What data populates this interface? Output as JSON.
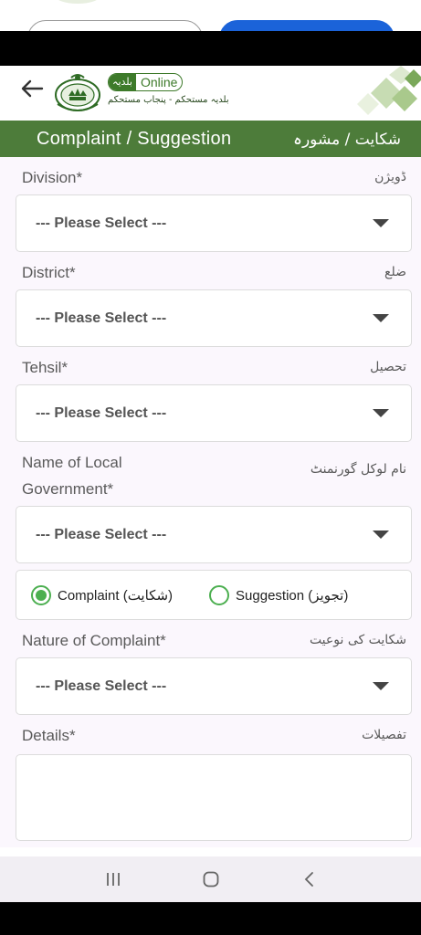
{
  "header": {
    "logo_pill_urdu": "بلدیہ",
    "logo_pill_en": "Online",
    "logo_tagline": "بلدیہ مستحکم - پنجاب مستحکم"
  },
  "title_bar": {
    "title_en": "Complaint / Suggestion",
    "title_ur": "شکایت / مشورہ"
  },
  "form": {
    "division": {
      "label_en": "Division*",
      "label_ur": "ڈویژن",
      "value": "--- Please Select ---"
    },
    "district": {
      "label_en": "District*",
      "label_ur": "ضلع",
      "value": "--- Please Select ---"
    },
    "tehsil": {
      "label_en": "Tehsil*",
      "label_ur": "تحصیل",
      "value": "--- Please Select ---"
    },
    "local_gov": {
      "label_en_line1": "Name of Local",
      "label_en_line2": "Government*",
      "label_ur": "نام لوکل گورنمنٹ",
      "value": "--- Please Select ---"
    },
    "type": {
      "complaint_label": "Complaint (شکایت)",
      "suggestion_label": "Suggestion (تجویز)",
      "selected": "complaint"
    },
    "nature": {
      "label_en": "Nature of Complaint*",
      "label_ur": "شکایت کی نوعیت",
      "value": "--- Please Select ---"
    },
    "details": {
      "label_en": "Details*",
      "label_ur": "تفصیلات",
      "value": ""
    }
  },
  "colors": {
    "brand_green": "#4d7c3a",
    "radio_green": "#4caf50",
    "form_bg": "#fbf7fd"
  },
  "navbar": {
    "icons": [
      "recents-icon",
      "home-icon",
      "back-icon"
    ]
  }
}
